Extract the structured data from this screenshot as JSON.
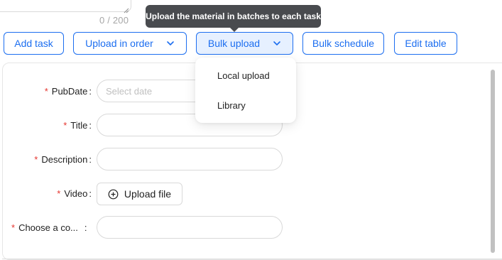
{
  "textarea": {
    "char_count": "0 / 200"
  },
  "tooltip": {
    "text": "Upload the material in batches to each task"
  },
  "toolbar": {
    "add_task": "Add task",
    "upload_in_order": "Upload in order",
    "bulk_upload": "Bulk upload",
    "bulk_schedule": "Bulk schedule",
    "edit_table": "Edit table"
  },
  "dropdown": {
    "items": [
      "Local upload",
      "Library"
    ]
  },
  "form": {
    "pubdate": {
      "label": "PubDate",
      "placeholder": "Select date"
    },
    "title": {
      "label": "Title"
    },
    "description": {
      "label": "Description"
    },
    "video": {
      "label": "Video",
      "upload_label": "Upload file"
    },
    "choose": {
      "label": "Choose a co..."
    },
    "required_mark": "*",
    "colon": ":"
  },
  "colors": {
    "accent": "#1c6ef0",
    "required": "#e5342e",
    "tooltip_bg": "#494b4f"
  },
  "icons": {
    "chevron": "chevron-down-icon",
    "upload": "plus-circle-icon",
    "resize": "resize-handle-icon"
  }
}
